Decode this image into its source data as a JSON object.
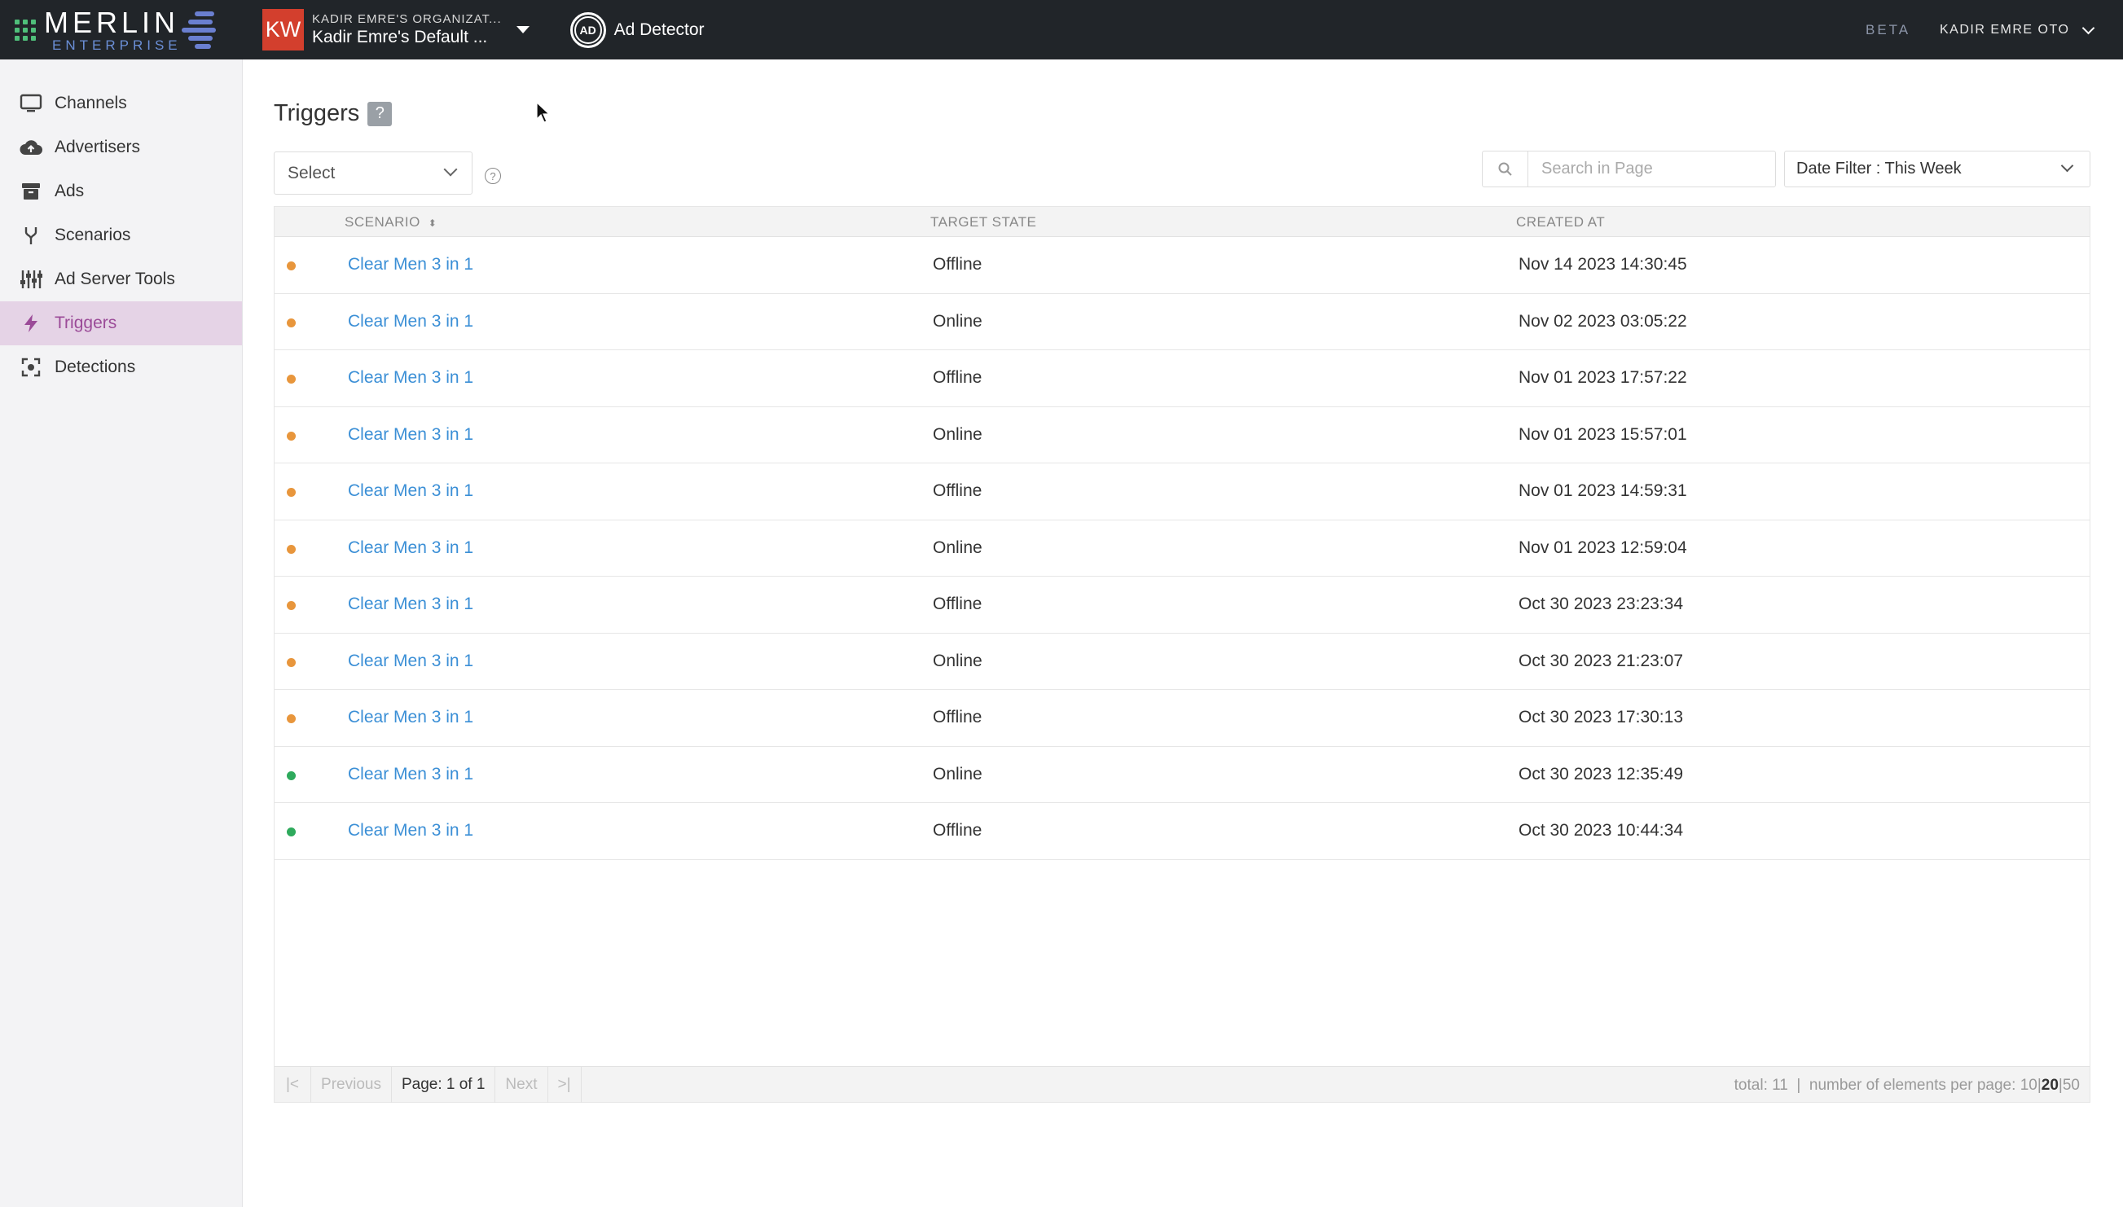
{
  "header": {
    "logo_main": "MERLIN",
    "logo_sub": "ENTERPRISE",
    "org_avatar": "KW",
    "org_small": "KADIR EMRE'S ORGANIZAT...",
    "org_name": "Kadir Emre's Default ...",
    "product_icon": "AD",
    "product_name": "Ad Detector",
    "beta": "BETA",
    "user": "KADIR EMRE OTO"
  },
  "sidebar": {
    "items": [
      {
        "label": "Channels",
        "icon": "monitor-icon"
      },
      {
        "label": "Advertisers",
        "icon": "cloud-upload-icon"
      },
      {
        "label": "Ads",
        "icon": "archive-icon"
      },
      {
        "label": "Scenarios",
        "icon": "branch-icon"
      },
      {
        "label": "Ad Server Tools",
        "icon": "sliders-icon"
      },
      {
        "label": "Triggers",
        "icon": "bolt-icon",
        "active": true
      },
      {
        "label": "Detections",
        "icon": "scan-icon"
      }
    ]
  },
  "page": {
    "title": "Triggers",
    "help": "?",
    "select_label": "Select",
    "info": "?",
    "search_placeholder": "Search in Page",
    "date_filter": "Date Filter : This Week"
  },
  "table": {
    "columns": [
      "SCENARIO",
      "TARGET STATE",
      "CREATED AT"
    ],
    "status_colors": {
      "pending": "#e8963c",
      "done": "#2eaa5c"
    },
    "rows": [
      {
        "status": "pending",
        "scenario": "Clear Men 3 in 1",
        "state": "Offline",
        "created": "Nov 14 2023 14:30:45"
      },
      {
        "status": "pending",
        "scenario": "Clear Men 3 in 1",
        "state": "Online",
        "created": "Nov 02 2023 03:05:22"
      },
      {
        "status": "pending",
        "scenario": "Clear Men 3 in 1",
        "state": "Offline",
        "created": "Nov 01 2023 17:57:22"
      },
      {
        "status": "pending",
        "scenario": "Clear Men 3 in 1",
        "state": "Online",
        "created": "Nov 01 2023 15:57:01"
      },
      {
        "status": "pending",
        "scenario": "Clear Men 3 in 1",
        "state": "Offline",
        "created": "Nov 01 2023 14:59:31"
      },
      {
        "status": "pending",
        "scenario": "Clear Men 3 in 1",
        "state": "Online",
        "created": "Nov 01 2023 12:59:04"
      },
      {
        "status": "pending",
        "scenario": "Clear Men 3 in 1",
        "state": "Offline",
        "created": "Oct 30 2023 23:23:34"
      },
      {
        "status": "pending",
        "scenario": "Clear Men 3 in 1",
        "state": "Online",
        "created": "Oct 30 2023 21:23:07"
      },
      {
        "status": "pending",
        "scenario": "Clear Men 3 in 1",
        "state": "Offline",
        "created": "Oct 30 2023 17:30:13"
      },
      {
        "status": "done",
        "scenario": "Clear Men 3 in 1",
        "state": "Online",
        "created": "Oct 30 2023 12:35:49"
      },
      {
        "status": "done",
        "scenario": "Clear Men 3 in 1",
        "state": "Offline",
        "created": "Oct 30 2023 10:44:34"
      }
    ]
  },
  "pager": {
    "first": "|<",
    "previous": "Previous",
    "page_info": "Page: 1 of 1",
    "next": "Next",
    "last": ">|",
    "total": "total: 11",
    "separator": "|",
    "per_page_label": "number of elements per page:",
    "sizes": [
      "10",
      "20",
      "50"
    ],
    "selected_size": "20"
  }
}
